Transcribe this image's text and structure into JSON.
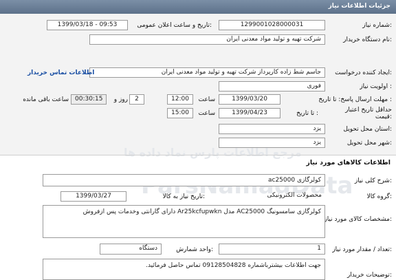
{
  "window": {
    "title": "جزئیات اطلاعات نیاز"
  },
  "details": {
    "need_number_label": "شماره نیاز:",
    "need_number": "1299001028000031",
    "announce_label": "تاریخ و ساعت اعلان عمومی:",
    "announce_value": "1399/03/18 - 09:53",
    "buyer_label": "نام دستگاه خریدار:",
    "buyer_value": "شرکت تهیه و تولید مواد معدنی ایران",
    "creator_label": "ایجاد کننده درخواست:",
    "creator_value": "جاسم شط زاده کارپرداز شرکت تهیه و تولید مواد معدنی ایران",
    "contact_link": "اطلاعات تماس خریدار",
    "priority_label": "اولویت نیاز :",
    "priority_value": "فوری",
    "deadline_label": "مهلت ارسال پاسخ: تا تاریخ :",
    "deadline_date": "1399/03/20",
    "time_label": "ساعت",
    "deadline_time": "12:00",
    "days_value": "2",
    "days_label": "روز و",
    "remaining_time": "00:30:15",
    "remaining_label": "ساعت باقی مانده",
    "validity_label_1": "حداقل تاریخ اعتبار",
    "validity_label_2": "قیمت:",
    "validity_to_label": "تا تاریخ :",
    "validity_date": "1399/04/23",
    "validity_time": "15:00",
    "province_label": "استان محل تحویل:",
    "province_value": "یزد",
    "city_label": "شهر محل تحویل:",
    "city_value": "یزد"
  },
  "goods": {
    "section_title": "اطلاعات کالاهای مورد نیاز",
    "general_label": "شرح کلی نیاز:",
    "general_value": "کولرگازی ac25000",
    "group_label": "گروه کالا:",
    "group_value": "محصولات الکترونیکی",
    "need_date_label": "تاریخ نیاز به کالا:",
    "need_date_value": "1399/03/27",
    "specs_label": "مشخصات کالای مورد نیاز:",
    "specs_value": "کولرگازی  سامسونیگ AC25000 مدل  Ar25kcfupwkn دارای گارانتی وخدمات پس ازفروش",
    "qty_label": "تعداد / مقدار مورد نیاز:",
    "qty_value": "1",
    "unit_label": "واحد شمارش:",
    "unit_value": "دستگاه",
    "buyer_notes_label": "توضیحات خریدار:",
    "buyer_notes_value": "جهت اطلاعات بیشترباشماره 09128504828 تماس حاصل فرمائید."
  },
  "watermark": {
    "latin": "ParsNamadData",
    "farsi": "مرجع اطلاعات پارس نماد داده ها"
  }
}
